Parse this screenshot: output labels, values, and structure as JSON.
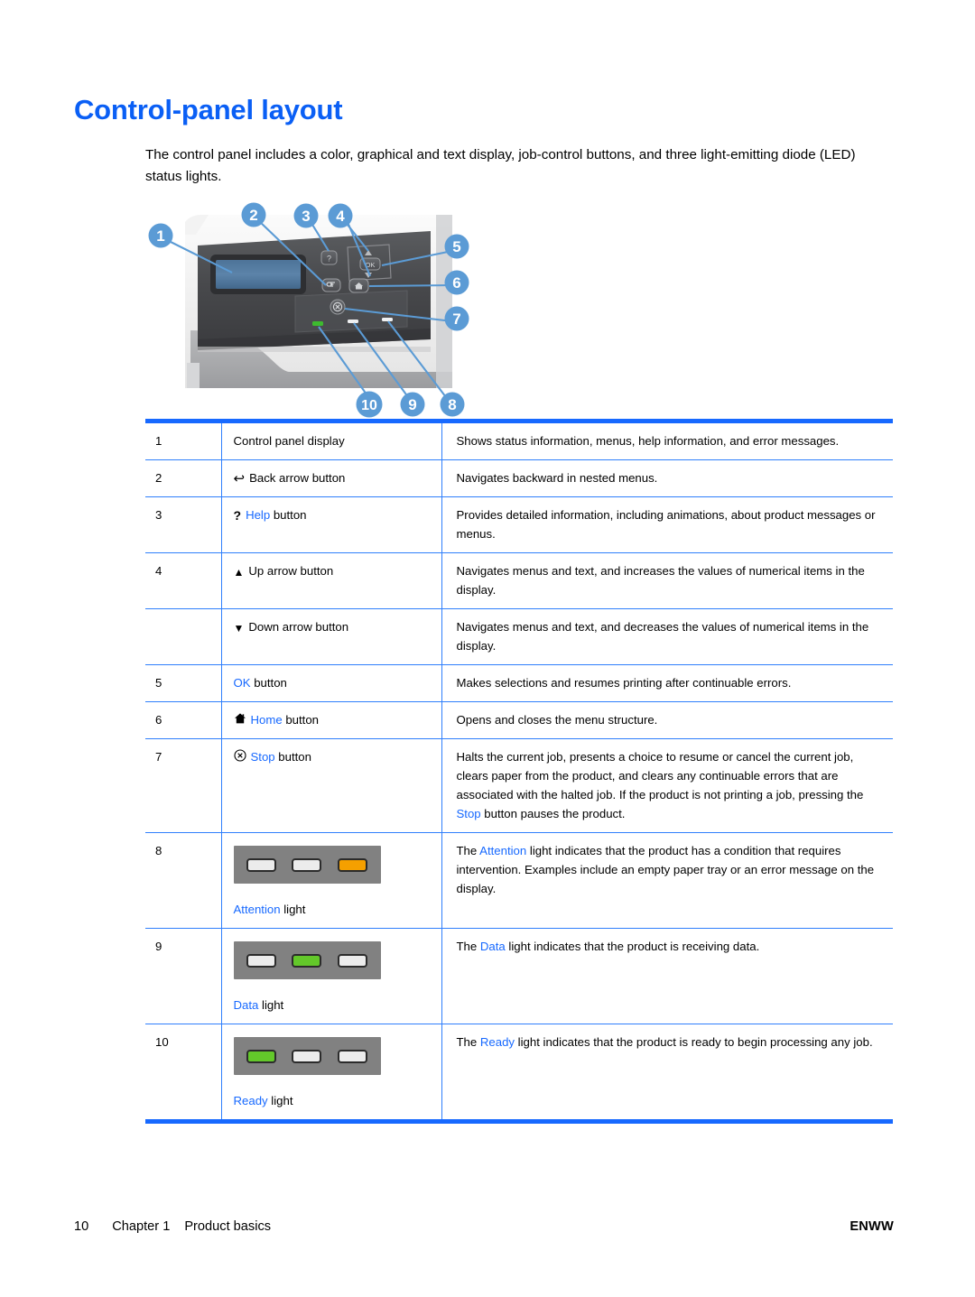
{
  "page": {
    "heading": "Control-panel layout",
    "intro": "The control panel includes a color, graphical and text display, job-control buttons, and three light-emitting diode (LED) status lights.",
    "accent_blue": "#1769ff",
    "heading_blue": "#0a5ff5",
    "callout_blue": "#5b9bd5"
  },
  "figure": {
    "name": "control-panel-diagram",
    "callouts": [
      {
        "number": "1",
        "target": "control panel display"
      },
      {
        "number": "2",
        "target": "Back arrow button"
      },
      {
        "number": "3",
        "target": "Help button"
      },
      {
        "number": "4",
        "target": "Up and Down arrow buttons"
      },
      {
        "number": "5",
        "target": "OK button"
      },
      {
        "number": "6",
        "target": "Home button"
      },
      {
        "number": "7",
        "target": "Stop button"
      },
      {
        "number": "8",
        "target": "Attention light"
      },
      {
        "number": "9",
        "target": "Data light"
      },
      {
        "number": "10",
        "target": "Ready light"
      }
    ],
    "panel_buttons": [
      "help",
      "back-arrow",
      "up-arrow",
      "ok",
      "down-arrow",
      "home",
      "stop"
    ],
    "panel_lights": [
      "ready",
      "data",
      "attention"
    ]
  },
  "table": {
    "rows": [
      {
        "num": "1",
        "icon": "none",
        "item_prefix": "",
        "item_blue": "",
        "item_plain": "Control panel display",
        "desc": "Shows status information, menus, help information, and error messages."
      },
      {
        "num": "2",
        "icon": "back-arrow",
        "item_prefix": "",
        "item_blue": "",
        "item_plain": "Back arrow button",
        "desc": "Navigates backward in nested menus."
      },
      {
        "num": "3",
        "icon": "question-mark",
        "item_prefix": "",
        "item_blue": "Help",
        "item_plain": " button",
        "desc": "Provides detailed information, including animations, about product messages or menus."
      },
      {
        "num": "4",
        "icon": "up-triangle",
        "item_prefix": "",
        "item_blue": "",
        "item_plain": "Up arrow button",
        "desc": "Navigates menus and text, and increases the values of numerical items in the display."
      },
      {
        "num": "",
        "icon": "down-triangle",
        "item_prefix": "",
        "item_blue": "",
        "item_plain": "Down arrow button",
        "desc": "Navigates menus and text, and decreases the values of numerical items in the display."
      },
      {
        "num": "5",
        "icon": "none",
        "item_prefix": "",
        "item_blue": "OK",
        "item_plain": " button",
        "desc": "Makes selections and resumes printing after continuable errors."
      },
      {
        "num": "6",
        "icon": "home",
        "item_prefix": "",
        "item_blue": "Home",
        "item_plain": " button",
        "desc": "Opens and closes the menu structure."
      },
      {
        "num": "7",
        "icon": "stop",
        "item_prefix": "",
        "item_blue": "Stop",
        "item_plain": " button",
        "desc_part1": "Halts the current job, presents a choice to resume or cancel the current job, clears paper from the product, and clears any continuable errors that are associated with the halted job. If the product is not printing a job, pressing the ",
        "desc_blue": "Stop",
        "desc_part2": " button pauses the product."
      },
      {
        "num": "8",
        "led_state": [
          "off",
          "off",
          "amber"
        ],
        "led_label_blue": "Attention",
        "led_label_plain": " light",
        "desc_part1": "The ",
        "desc_blue": "Attention",
        "desc_part2": " light indicates that the product has a condition that requires intervention. Examples include an empty paper tray or an error message on the display."
      },
      {
        "num": "9",
        "led_state": [
          "off",
          "green",
          "off"
        ],
        "led_label_blue": "Data",
        "led_label_plain": " light",
        "desc_part1": "The ",
        "desc_blue": "Data",
        "desc_part2": " light indicates that the product is receiving data."
      },
      {
        "num": "10",
        "led_state": [
          "green",
          "off",
          "off"
        ],
        "led_label_blue": "Ready",
        "led_label_plain": " light",
        "desc_part1": "The ",
        "desc_blue": "Ready",
        "desc_part2": " light indicates that the product is ready to begin processing any job."
      }
    ]
  },
  "footer": {
    "page_number": "10",
    "chapter": "Chapter 1",
    "chapter_title": "Product basics",
    "locale": "ENWW"
  }
}
